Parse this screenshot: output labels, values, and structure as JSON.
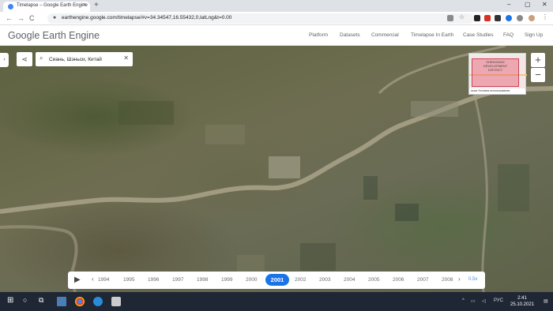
{
  "browser": {
    "tab_title": "Timelapse – Google Earth Engine",
    "tab_close": "×",
    "new_tab": "+",
    "url": "earthengine.google.com/timelapse/#v=34.34547,16.55432,0,latLng&t=0.00",
    "back": "←",
    "forward": "→",
    "reload": "C",
    "home": "⌂",
    "lock": "🔒",
    "win_min": "–",
    "win_max": "▢",
    "win_close": "✕"
  },
  "site": {
    "logo": "Google Earth Engine",
    "nav": [
      "Platform",
      "Datasets",
      "Commercial",
      "Timelapse In Earth",
      "Case Studies",
      "FAQ",
      "Sign Up"
    ]
  },
  "map": {
    "search_value": "Сиань, Шэньси, Китай",
    "side_toggle": "›",
    "share": "⋖",
    "search_icon": "⌕",
    "clear": "✕",
    "zoom_in": "+",
    "zoom_out": "−",
    "minimap_label": "SHENXIANG DEVELOPMENT DISTRICT",
    "minimap_terms": "ньые  Условия использования"
  },
  "timeline": {
    "play": "▶",
    "prev": "‹",
    "next": "›",
    "years": [
      "1994",
      "1995",
      "1996",
      "1997",
      "1998",
      "1999",
      "2000",
      "2001",
      "2002",
      "2003",
      "2004",
      "2005",
      "2006",
      "2007",
      "2008"
    ],
    "selected_year": "2001",
    "speed": "0.5x"
  },
  "taskbar": {
    "time": "2:41",
    "date": "25.10.2021",
    "lang": "РУС"
  },
  "colors": {
    "accent": "#1a73e8"
  }
}
